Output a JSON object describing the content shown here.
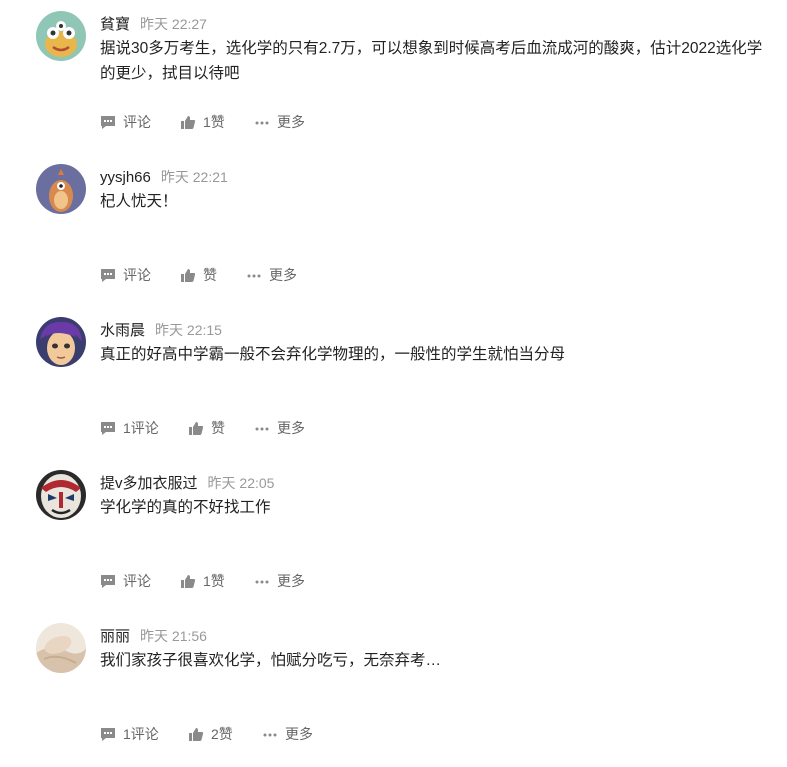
{
  "comments": [
    {
      "username": "貧寶",
      "time": "昨天 22:27",
      "text": "据说30多万考生，选化学的只有2.7万，可以想象到时候高考后血流成河的酸爽，估计2022选化学的更少，拭目以待吧",
      "comment_label": "评论",
      "like_label": "1赞",
      "more_label": "更多",
      "avatar": "cartoon-monster"
    },
    {
      "username": "yysjh66",
      "time": "昨天 22:21",
      "text": "杞人忧天！",
      "comment_label": "评论",
      "like_label": "赞",
      "more_label": "更多",
      "avatar": "cartoon-bird"
    },
    {
      "username": "水雨晨",
      "time": "昨天 22:15",
      "text": "真正的好高中学霸一般不会弃化学物理的，一般性的学生就怕当分母",
      "comment_label": "1评论",
      "like_label": "赞",
      "more_label": "更多",
      "avatar": "anime-boy"
    },
    {
      "username": "提v多加衣服过",
      "time": "昨天 22:05",
      "text": "学化学的真的不好找工作",
      "comment_label": "评论",
      "like_label": "1赞",
      "more_label": "更多",
      "avatar": "opera-mask"
    },
    {
      "username": "丽丽",
      "time": "昨天 21:56",
      "text": "我们家孩子很喜欢化学，怕赋分吃亏，无奈弃考…",
      "comment_label": "1评论",
      "like_label": "2赞",
      "more_label": "更多",
      "avatar": "photo-hand"
    }
  ],
  "colors": {
    "text": "#222222",
    "muted": "#999999",
    "action": "#666666",
    "icon": "#8a8a8a"
  }
}
